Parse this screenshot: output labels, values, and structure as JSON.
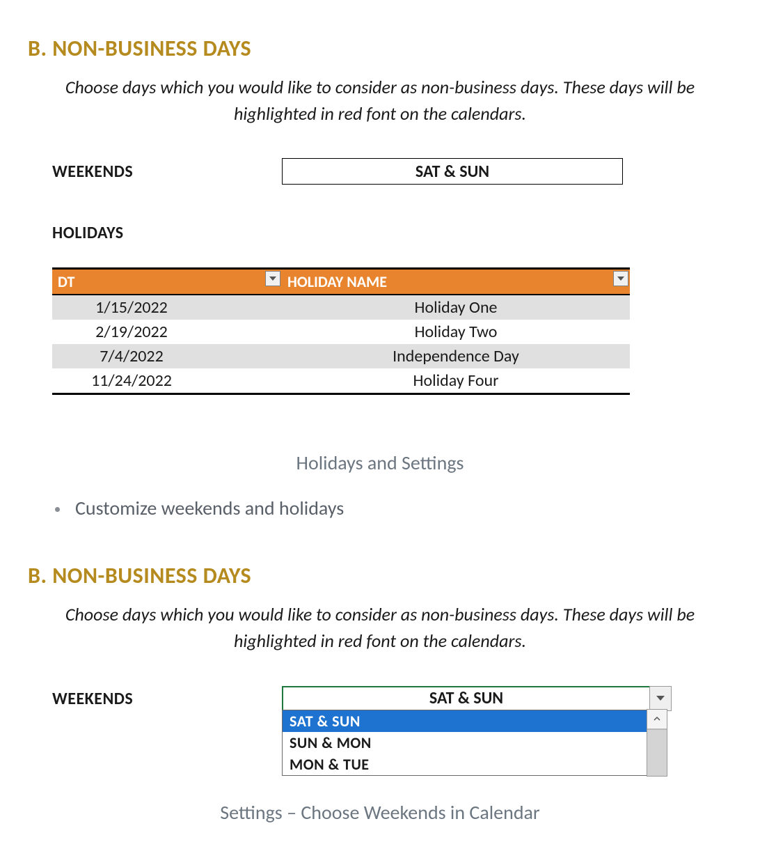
{
  "section1": {
    "title": "B. NON-BUSINESS DAYS",
    "description": "Choose days which you would like to consider as non-business days. These days will be highlighted in red font on the calendars.",
    "weekends_label": "WEEKENDS",
    "weekends_value": "SAT & SUN",
    "holidays_label": "HOLIDAYS",
    "table": {
      "col_dt": "DT",
      "col_name": "HOLIDAY NAME",
      "rows": [
        {
          "dt": "1/15/2022",
          "name": "Holiday One"
        },
        {
          "dt": "2/19/2022",
          "name": "Holiday Two"
        },
        {
          "dt": "7/4/2022",
          "name": "Independence Day"
        },
        {
          "dt": "11/24/2022",
          "name": "Holiday Four"
        }
      ]
    },
    "caption": "Holidays and Settings"
  },
  "bullet": "Customize weekends and holidays",
  "section2": {
    "title": "B. NON-BUSINESS DAYS",
    "description": "Choose days which you would like to consider as non-business days. These days will be highlighted in red font on the calendars.",
    "weekends_label": "WEEKENDS",
    "weekends_value": "SAT & SUN",
    "options": [
      "SAT & SUN",
      "SUN & MON",
      "MON & TUE"
    ],
    "caption": "Settings – Choose Weekends in Calendar"
  }
}
